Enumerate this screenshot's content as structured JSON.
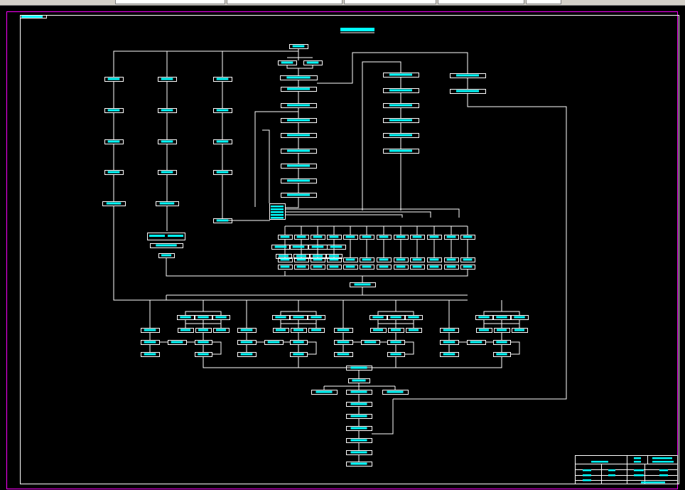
{
  "toolbar": {
    "icons": [
      "pencil-icon",
      "globe-icon"
    ],
    "dropdowns": [
      {
        "value": ""
      },
      {
        "value": ""
      },
      {
        "value": ""
      },
      {
        "value": ""
      },
      {
        "value": ""
      }
    ]
  },
  "drawing": {
    "colors": {
      "background": "#000000",
      "frame": "#ff00ff",
      "line": "#ffffff",
      "box_fill": "#00ffff"
    },
    "title_block": {
      "caption": "",
      "label_count": 10
    }
  }
}
